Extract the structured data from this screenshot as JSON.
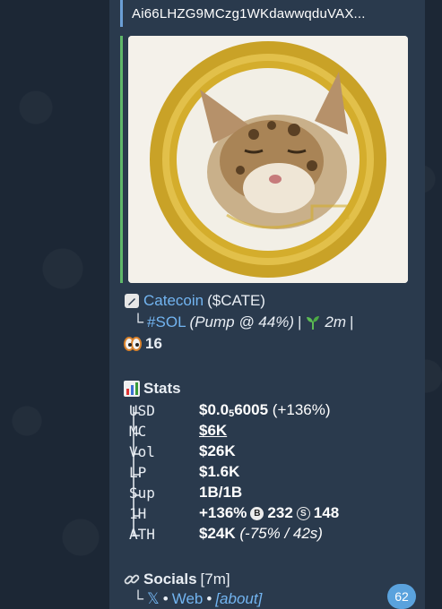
{
  "message": {
    "contract_address": "Ai66LHZG9MCzg1WKdawwqduVAX...",
    "token_name": "Catecoin",
    "token_ticker": "($CATE)",
    "chain_tag": "#SOL",
    "pump_text": "(Pump @ 44%)",
    "separator": "|",
    "age": "2m",
    "watchers_count": "16",
    "stats_title": "Stats",
    "stats": [
      {
        "label": "USD",
        "value_main": "$0.0",
        "value_sub": "5",
        "value_rest": "6005",
        "value_change": "(+136%)"
      },
      {
        "label": "MC",
        "value_main": "$6K"
      },
      {
        "label": "Vol",
        "value_main": "$26K"
      },
      {
        "label": "LP",
        "value_main": "$1.6K"
      },
      {
        "label": "Sup",
        "value_main": "1B/1B"
      },
      {
        "label": "1H",
        "value_main": "+136%",
        "buys": "232",
        "sells": "148",
        "buy_icon_letter": "B",
        "sell_icon_letter": "S"
      },
      {
        "label": "ATH",
        "value_main": "$24K",
        "value_change": "(-75% / 42s)"
      }
    ],
    "socials_title": "Socials",
    "socials_age": "[7m]",
    "social_links": [
      "𝕏",
      "Web",
      "[about]"
    ],
    "social_sep": "•",
    "tree_branch": "└",
    "unread_count": "62"
  },
  "colors": {
    "link": "#72b4f0",
    "bubble": "#2a3a4d",
    "background": "#1c2735",
    "media_border": "#5fb86a",
    "quote_border": "#6b9fd6",
    "badge": "#5aa2dd"
  },
  "icons": [
    "pencil-icon",
    "seedling-icon",
    "eyes-icon",
    "bar-chart-icon",
    "link-icon",
    "buy-coin-icon",
    "sell-coin-icon"
  ]
}
